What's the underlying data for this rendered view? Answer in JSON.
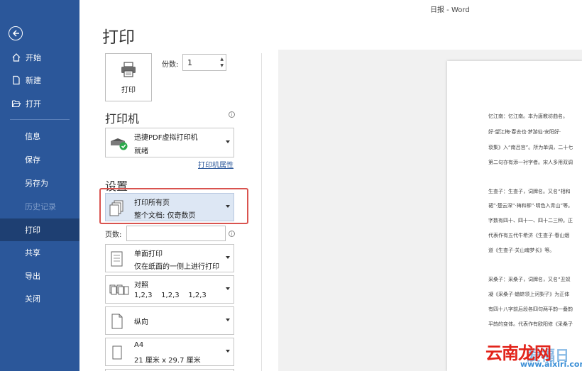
{
  "window": {
    "title": "日报 - Word"
  },
  "sidebar": {
    "items": [
      {
        "label": "开始"
      },
      {
        "label": "新建"
      },
      {
        "label": "打开"
      },
      {
        "label": "信息"
      },
      {
        "label": "保存"
      },
      {
        "label": "另存为"
      },
      {
        "label": "历史记录"
      },
      {
        "label": "打印"
      },
      {
        "label": "共享"
      },
      {
        "label": "导出"
      },
      {
        "label": "关闭"
      }
    ]
  },
  "print": {
    "title": "打印",
    "button_label": "打印",
    "copies_label": "份数:",
    "copies_value": "1"
  },
  "printer": {
    "section_title": "打印机",
    "name": "迅捷PDF虚拟打印机",
    "status": "就绪",
    "properties_link": "打印机属性"
  },
  "settings": {
    "section_title": "设置",
    "range": {
      "line1": "打印所有页",
      "line2": "整个文档: 仅奇数页"
    },
    "pages_label": "页数:",
    "sides": {
      "line1": "单面打印",
      "line2": "仅在纸面的一侧上进行打印"
    },
    "collate": {
      "line1": "对照",
      "line2": "1,2,3    1,2,3    1,2,3"
    },
    "orientation": {
      "line1": "纵向"
    },
    "paper": {
      "line1": "A4",
      "line2": "21 厘米 x 29.7 厘米"
    }
  },
  "preview": {
    "lines": [
      "忆江南：忆江南。本为唐教坊曲名。",
      "好·望江梅·春去也·梦游仙·安阳好·",
      "袞集》入“南吕宫”。所为单调，二十七",
      "第二句亦有添一衬字者。宋人多用双调",
      "生查子：生查子，词牌名。又名“相和",
      "裙”·楚云深“·梅和柳”·晴色入青山”等。",
      "字数有四十、四十一、四十二三种。正",
      "代表作有五代牛希济《生查子·春山烟",
      "道《生查子·关山魂梦长》等。",
      "采桑子：采桑子，词牌名，又名“丑奴",
      "凝《采桑子·蝤蛴领上诃梨子》为正体",
      "有四十八字前后段各四句两平韵一叠韵",
      "平韵的变体。代表作有欧阳修《采桑子"
    ]
  },
  "watermark": {
    "text1": "云南龙网",
    "text2": "爱福日",
    "url": "www.aixiri.com"
  },
  "colors": {
    "sidebar": "#2b579a",
    "sidebar_active": "#1e3f72",
    "highlight": "#d9534f"
  }
}
